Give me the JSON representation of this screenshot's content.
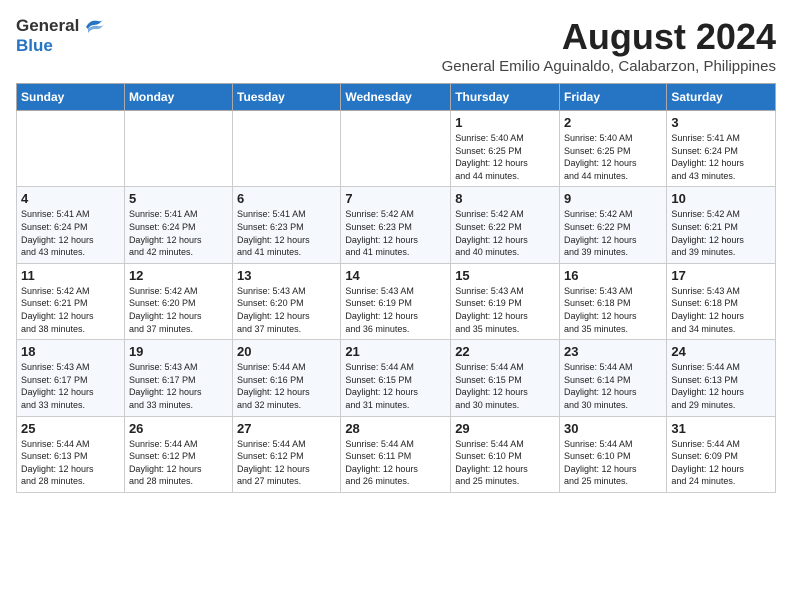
{
  "header": {
    "logo_general": "General",
    "logo_blue": "Blue",
    "month_year": "August 2024",
    "location": "General Emilio Aguinaldo, Calabarzon, Philippines"
  },
  "weekdays": [
    "Sunday",
    "Monday",
    "Tuesday",
    "Wednesday",
    "Thursday",
    "Friday",
    "Saturday"
  ],
  "weeks": [
    [
      {
        "day": "",
        "text": ""
      },
      {
        "day": "",
        "text": ""
      },
      {
        "day": "",
        "text": ""
      },
      {
        "day": "",
        "text": ""
      },
      {
        "day": "1",
        "text": "Sunrise: 5:40 AM\nSunset: 6:25 PM\nDaylight: 12 hours\nand 44 minutes."
      },
      {
        "day": "2",
        "text": "Sunrise: 5:40 AM\nSunset: 6:25 PM\nDaylight: 12 hours\nand 44 minutes."
      },
      {
        "day": "3",
        "text": "Sunrise: 5:41 AM\nSunset: 6:24 PM\nDaylight: 12 hours\nand 43 minutes."
      }
    ],
    [
      {
        "day": "4",
        "text": "Sunrise: 5:41 AM\nSunset: 6:24 PM\nDaylight: 12 hours\nand 43 minutes."
      },
      {
        "day": "5",
        "text": "Sunrise: 5:41 AM\nSunset: 6:24 PM\nDaylight: 12 hours\nand 42 minutes."
      },
      {
        "day": "6",
        "text": "Sunrise: 5:41 AM\nSunset: 6:23 PM\nDaylight: 12 hours\nand 41 minutes."
      },
      {
        "day": "7",
        "text": "Sunrise: 5:42 AM\nSunset: 6:23 PM\nDaylight: 12 hours\nand 41 minutes."
      },
      {
        "day": "8",
        "text": "Sunrise: 5:42 AM\nSunset: 6:22 PM\nDaylight: 12 hours\nand 40 minutes."
      },
      {
        "day": "9",
        "text": "Sunrise: 5:42 AM\nSunset: 6:22 PM\nDaylight: 12 hours\nand 39 minutes."
      },
      {
        "day": "10",
        "text": "Sunrise: 5:42 AM\nSunset: 6:21 PM\nDaylight: 12 hours\nand 39 minutes."
      }
    ],
    [
      {
        "day": "11",
        "text": "Sunrise: 5:42 AM\nSunset: 6:21 PM\nDaylight: 12 hours\nand 38 minutes."
      },
      {
        "day": "12",
        "text": "Sunrise: 5:42 AM\nSunset: 6:20 PM\nDaylight: 12 hours\nand 37 minutes."
      },
      {
        "day": "13",
        "text": "Sunrise: 5:43 AM\nSunset: 6:20 PM\nDaylight: 12 hours\nand 37 minutes."
      },
      {
        "day": "14",
        "text": "Sunrise: 5:43 AM\nSunset: 6:19 PM\nDaylight: 12 hours\nand 36 minutes."
      },
      {
        "day": "15",
        "text": "Sunrise: 5:43 AM\nSunset: 6:19 PM\nDaylight: 12 hours\nand 35 minutes."
      },
      {
        "day": "16",
        "text": "Sunrise: 5:43 AM\nSunset: 6:18 PM\nDaylight: 12 hours\nand 35 minutes."
      },
      {
        "day": "17",
        "text": "Sunrise: 5:43 AM\nSunset: 6:18 PM\nDaylight: 12 hours\nand 34 minutes."
      }
    ],
    [
      {
        "day": "18",
        "text": "Sunrise: 5:43 AM\nSunset: 6:17 PM\nDaylight: 12 hours\nand 33 minutes."
      },
      {
        "day": "19",
        "text": "Sunrise: 5:43 AM\nSunset: 6:17 PM\nDaylight: 12 hours\nand 33 minutes."
      },
      {
        "day": "20",
        "text": "Sunrise: 5:44 AM\nSunset: 6:16 PM\nDaylight: 12 hours\nand 32 minutes."
      },
      {
        "day": "21",
        "text": "Sunrise: 5:44 AM\nSunset: 6:15 PM\nDaylight: 12 hours\nand 31 minutes."
      },
      {
        "day": "22",
        "text": "Sunrise: 5:44 AM\nSunset: 6:15 PM\nDaylight: 12 hours\nand 30 minutes."
      },
      {
        "day": "23",
        "text": "Sunrise: 5:44 AM\nSunset: 6:14 PM\nDaylight: 12 hours\nand 30 minutes."
      },
      {
        "day": "24",
        "text": "Sunrise: 5:44 AM\nSunset: 6:13 PM\nDaylight: 12 hours\nand 29 minutes."
      }
    ],
    [
      {
        "day": "25",
        "text": "Sunrise: 5:44 AM\nSunset: 6:13 PM\nDaylight: 12 hours\nand 28 minutes."
      },
      {
        "day": "26",
        "text": "Sunrise: 5:44 AM\nSunset: 6:12 PM\nDaylight: 12 hours\nand 28 minutes."
      },
      {
        "day": "27",
        "text": "Sunrise: 5:44 AM\nSunset: 6:12 PM\nDaylight: 12 hours\nand 27 minutes."
      },
      {
        "day": "28",
        "text": "Sunrise: 5:44 AM\nSunset: 6:11 PM\nDaylight: 12 hours\nand 26 minutes."
      },
      {
        "day": "29",
        "text": "Sunrise: 5:44 AM\nSunset: 6:10 PM\nDaylight: 12 hours\nand 25 minutes."
      },
      {
        "day": "30",
        "text": "Sunrise: 5:44 AM\nSunset: 6:10 PM\nDaylight: 12 hours\nand 25 minutes."
      },
      {
        "day": "31",
        "text": "Sunrise: 5:44 AM\nSunset: 6:09 PM\nDaylight: 12 hours\nand 24 minutes."
      }
    ]
  ]
}
